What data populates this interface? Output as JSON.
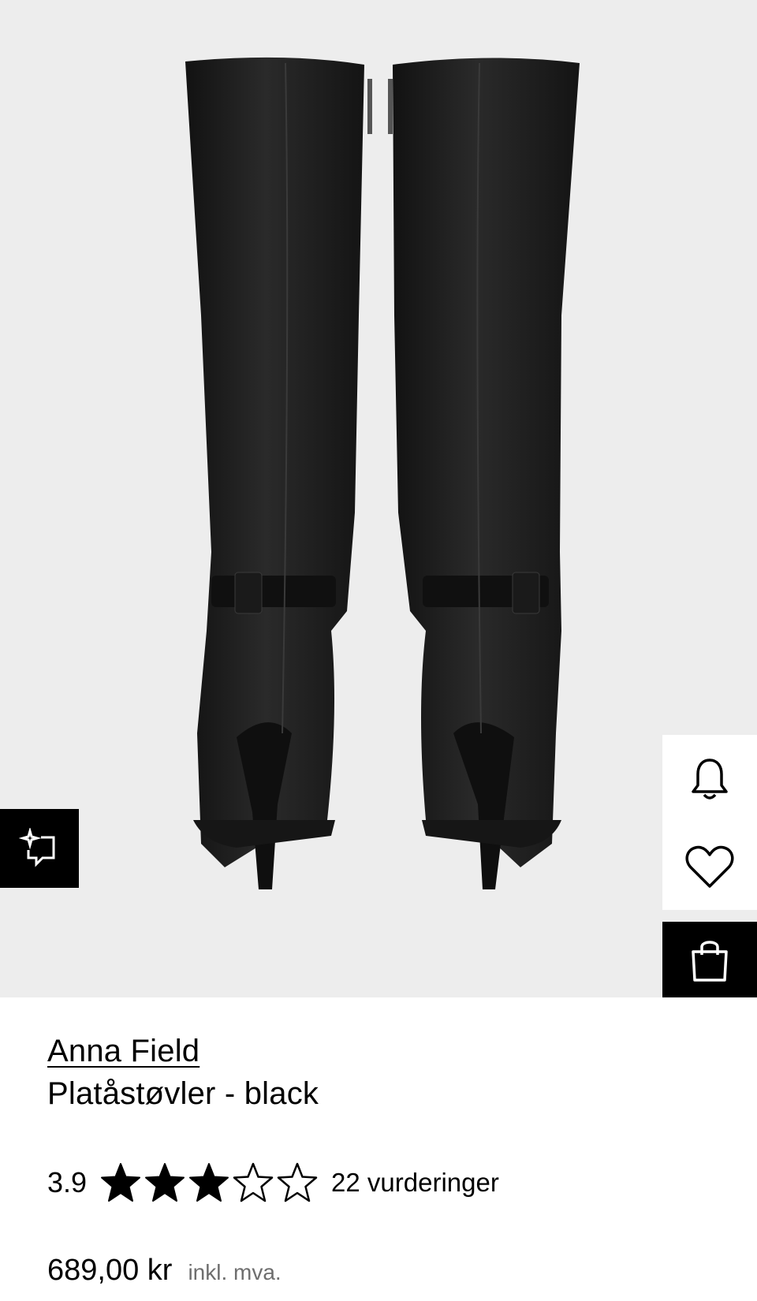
{
  "product": {
    "brand": "Anna Field",
    "name": "Platåstøvler - black",
    "rating_value": "3.9",
    "rating_stars": 3.9,
    "rating_max": 5,
    "rating_count": "22 vurderinger",
    "price": "689,00 kr",
    "vat_note": "inkl. mva."
  },
  "image": {
    "background": "#ededed",
    "boot_color": "#1c1c1c"
  },
  "actions": {
    "similar_icon": "sparkle-frame-icon",
    "notify_icon": "bell-icon",
    "wishlist_icon": "heart-icon",
    "bag_icon": "shopping-bag-icon"
  }
}
